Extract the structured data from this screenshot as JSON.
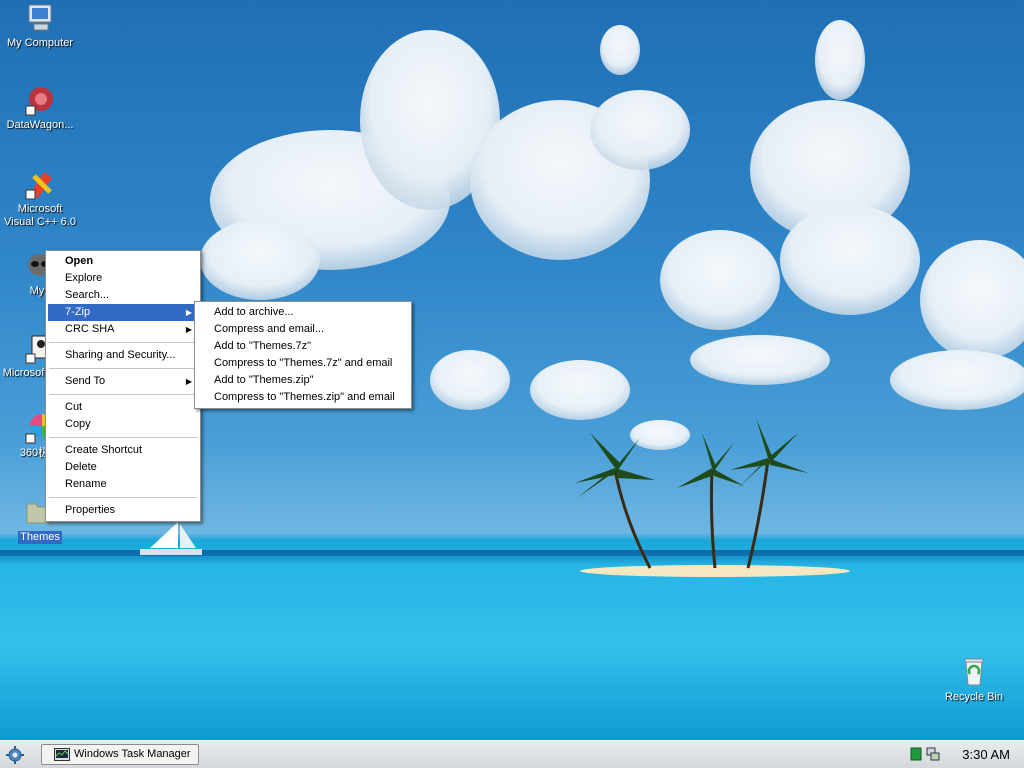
{
  "desktop": {
    "icons": [
      {
        "name": "my-computer",
        "label": "My Computer"
      },
      {
        "name": "datawagon",
        "label": "DataWagon..."
      },
      {
        "name": "visual-cpp",
        "label": "Microsoft Visual C++ 6.0"
      },
      {
        "name": "myp",
        "label": "Myp"
      },
      {
        "name": "vb",
        "label": "Microsoft Basic"
      },
      {
        "name": "browser-360",
        "label": "360极速"
      },
      {
        "name": "themes",
        "label": "Themes"
      },
      {
        "name": "recycle-bin",
        "label": "Recycle Bin"
      }
    ]
  },
  "context_menu": {
    "items": [
      {
        "label": "Open"
      },
      {
        "label": "Explore"
      },
      {
        "label": "Search..."
      },
      {
        "label": "7-Zip"
      },
      {
        "label": "CRC SHA"
      },
      {
        "label": "Sharing and Security..."
      },
      {
        "label": "Send To"
      },
      {
        "label": "Cut"
      },
      {
        "label": "Copy"
      },
      {
        "label": "Create Shortcut"
      },
      {
        "label": "Delete"
      },
      {
        "label": "Rename"
      },
      {
        "label": "Properties"
      }
    ]
  },
  "submenu": {
    "items": [
      {
        "label": "Add to archive..."
      },
      {
        "label": "Compress and email..."
      },
      {
        "label": "Add to \"Themes.7z\""
      },
      {
        "label": "Compress to \"Themes.7z\" and email"
      },
      {
        "label": "Add to \"Themes.zip\""
      },
      {
        "label": "Compress to \"Themes.zip\" and email"
      }
    ]
  },
  "taskbar": {
    "task_label": "Windows Task Manager",
    "clock": "3:30 AM"
  },
  "colors": {
    "highlight": "#316ac5",
    "sky": "#2f86c8",
    "sea": "#1aa6d8"
  }
}
